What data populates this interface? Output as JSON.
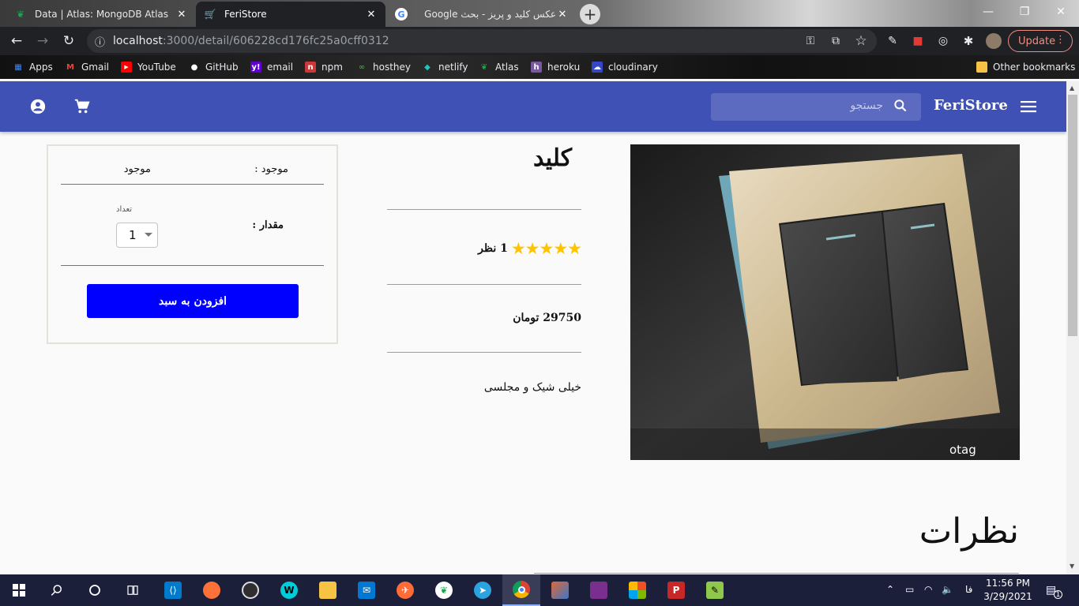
{
  "browser": {
    "tabs": [
      {
        "title": "Data | Atlas: MongoDB Atlas",
        "icon": "mongodb-leaf-icon",
        "active": false
      },
      {
        "title": "FeriStore",
        "icon": "cart-favicon-icon",
        "active": true
      },
      {
        "title": "عکس کلید و پریز - بحث Google",
        "icon": "google-icon",
        "active": false
      }
    ],
    "close_glyph": "✕",
    "new_tab_glyph": "+",
    "url_host": "localhost",
    "url_path": ":3000/detail/606228cd176fc25a0cff0312",
    "update_label": "Update",
    "bookmarks": [
      {
        "label": "Apps",
        "icon": "apps-grid-icon",
        "color": "#4285f4"
      },
      {
        "label": "Gmail",
        "icon": "gmail-icon",
        "color": "#ea4335"
      },
      {
        "label": "YouTube",
        "icon": "youtube-icon",
        "color": "#ff0000"
      },
      {
        "label": "GitHub",
        "icon": "github-icon",
        "color": "#ffffff"
      },
      {
        "label": "email",
        "icon": "yahoo-icon",
        "color": "#6001d2"
      },
      {
        "label": "npm",
        "icon": "npm-icon",
        "color": "#cb3837"
      },
      {
        "label": "hosthey",
        "icon": "hosthey-icon",
        "color": "#2e7d32"
      },
      {
        "label": "netlify",
        "icon": "netlify-icon",
        "color": "#20c6b7"
      },
      {
        "label": "Atlas",
        "icon": "mongodb-leaf-icon",
        "color": "#13aa52"
      },
      {
        "label": "heroku",
        "icon": "heroku-icon",
        "color": "#79589f"
      },
      {
        "label": "cloudinary",
        "icon": "cloudinary-icon",
        "color": "#3448c5"
      }
    ],
    "other_bookmarks": "Other bookmarks"
  },
  "app": {
    "brand": "FeriStore",
    "search_placeholder": "جستجو",
    "accent": "#3f51b5"
  },
  "product": {
    "name": "کلید",
    "rating_stars": 5,
    "star_glyphs": "★★★★★",
    "reviews_count": "1 نظر",
    "price": "29750 تومان",
    "description": "خیلی شیک و مجلسی",
    "image_watermark": "otag"
  },
  "buybox": {
    "status_label": "موجود :",
    "status_value": "موجود",
    "quantity_label": "مقدار :",
    "quantity_field_label": "تعداد",
    "quantity_value": "1",
    "add_to_cart": "افزودن به سبد",
    "button_color": "#0000ff"
  },
  "reviews": {
    "title": "نظرات"
  },
  "taskbar": {
    "apps": [
      "windows-start-icon",
      "search-icon",
      "cortana-icon",
      "task-view-icon",
      "vscode-icon",
      "firefox-icon",
      "obs-icon",
      "webstorm-icon",
      "file-explorer-icon",
      "mail-icon",
      "postman-icon",
      "mongodb-compass-icon",
      "telegram-icon",
      "chrome-icon",
      "matlab-icon",
      "winrar-icon",
      "office-icon",
      "psiphon-icon",
      "notepadpp-icon"
    ],
    "lang": "فا",
    "time": "11:56 PM",
    "date": "3/29/2021",
    "notifications": "1"
  }
}
